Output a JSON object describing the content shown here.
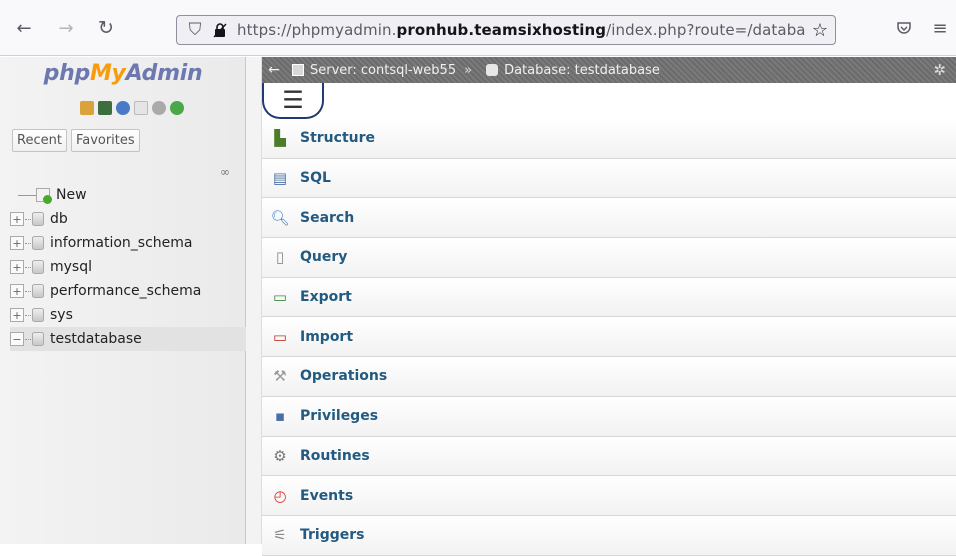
{
  "browser": {
    "url_prefix": "https://phpmyadmin.",
    "url_host": "pronhub.teamsixhosting",
    "url_suffix": "/index.php?route=/database"
  },
  "logo": {
    "php": "php",
    "my": "My",
    "admin": "Admin"
  },
  "nav": {
    "tabs": [
      "Recent",
      "Favorites"
    ],
    "tree": [
      {
        "label": "New",
        "kind": "new"
      },
      {
        "label": "db",
        "kind": "db"
      },
      {
        "label": "information_schema",
        "kind": "db"
      },
      {
        "label": "mysql",
        "kind": "db"
      },
      {
        "label": "performance_schema",
        "kind": "db"
      },
      {
        "label": "sys",
        "kind": "db"
      },
      {
        "label": "testdatabase",
        "kind": "db",
        "active": true
      }
    ]
  },
  "breadcrumb": {
    "server": "Server: contsql-web55",
    "separator": "»",
    "database": "Database: testdatabase"
  },
  "menu": {
    "items": [
      {
        "label": "Structure",
        "icon": "structure-icon",
        "color": "#4a7c2a"
      },
      {
        "label": "SQL",
        "icon": "sql-icon",
        "color": "#4a6fa5"
      },
      {
        "label": "Search",
        "icon": "search-icon",
        "color": "#3b7fc4"
      },
      {
        "label": "Query",
        "icon": "query-icon",
        "color": "#8a8a8a"
      },
      {
        "label": "Export",
        "icon": "export-icon",
        "color": "#3e8e3e"
      },
      {
        "label": "Import",
        "icon": "import-icon",
        "color": "#c0392b"
      },
      {
        "label": "Operations",
        "icon": "wrench-icon",
        "color": "#999999"
      },
      {
        "label": "Privileges",
        "icon": "privileges-icon",
        "color": "#4a6fa5"
      },
      {
        "label": "Routines",
        "icon": "routines-icon",
        "color": "#777777"
      },
      {
        "label": "Events",
        "icon": "events-icon",
        "color": "#d9342b"
      },
      {
        "label": "Triggers",
        "icon": "triggers-icon",
        "color": "#888888"
      }
    ]
  }
}
